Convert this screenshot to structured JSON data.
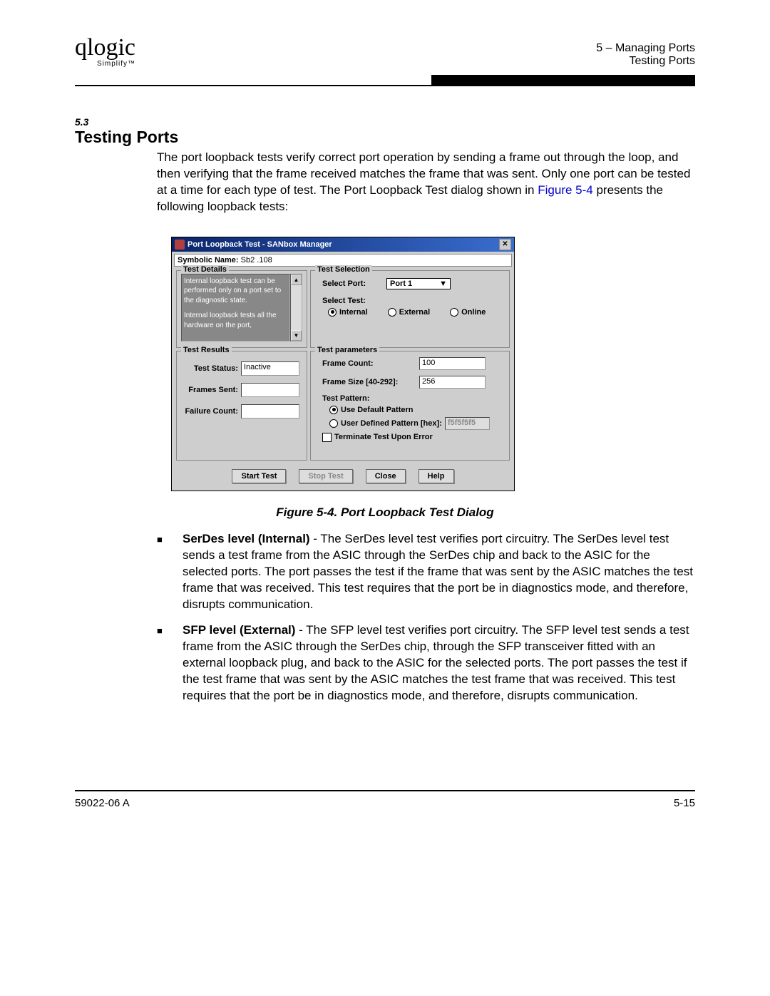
{
  "header": {
    "logo": "qlogic",
    "logo_sub": "Simplify™",
    "chapter": "5 – Managing Ports",
    "page_topic": "Testing Ports"
  },
  "section": {
    "num": "5.3",
    "title": "Testing Ports",
    "intro_a": "The port loopback tests verify correct port operation by sending a frame out through the loop, and then verifying that the frame received matches the frame that was sent. Only one port can be tested at a time for each type of test. The Port Loopback Test dialog shown in ",
    "intro_link": "Figure 5-4",
    "intro_b": " presents the following loopback tests:"
  },
  "dialog": {
    "title": "Port Loopback Test - SANbox Manager",
    "sym_label": "Symbolic Name:",
    "sym_value": "Sb2 .108",
    "details_label": "Test Details",
    "details_p1": "Internal loopback test can be performed only on a port set to the diagnostic state.",
    "details_p2": "Internal loopback tests all the hardware on the port,",
    "selection_label": "Test Selection",
    "select_port_label": "Select Port:",
    "select_port_value": "Port 1",
    "select_test_label": "Select Test:",
    "radio_internal": "Internal",
    "radio_external": "External",
    "radio_online": "Online",
    "results_label": "Test Results",
    "test_status_label": "Test Status:",
    "test_status_value": "Inactive",
    "frames_sent_label": "Frames Sent:",
    "frames_sent_value": "",
    "failure_count_label": "Failure Count:",
    "failure_count_value": "",
    "params_label": "Test parameters",
    "frame_count_label": "Frame Count:",
    "frame_count_value": "100",
    "frame_size_label": "Frame Size [40-292]:",
    "frame_size_value": "256",
    "test_pattern_label": "Test Pattern:",
    "use_default_label": "Use Default Pattern",
    "user_defined_label": "User Defined Pattern [hex]:",
    "user_defined_value": "f5f5f5f5",
    "terminate_label": "Terminate Test Upon Error",
    "btn_start": "Start Test",
    "btn_stop": "Stop Test",
    "btn_close": "Close",
    "btn_help": "Help"
  },
  "figure_caption": "Figure 5-4.  Port Loopback Test Dialog",
  "bullets": {
    "b1_bold": "SerDes level (Internal)",
    "b1_text": " - The SerDes level test verifies port circuitry. The SerDes level test sends a test frame from the ASIC through the SerDes chip and back to the ASIC for the selected ports. The port passes the test if the frame that was sent by the ASIC matches the test frame that was received. This test requires that the port be in diagnostics mode, and therefore, disrupts communication.",
    "b2_bold": "SFP level (External)",
    "b2_text": " - The SFP level test verifies port circuitry. The SFP level test sends a test frame from the ASIC through the SerDes chip, through the SFP transceiver fitted with an external loopback plug, and back to the ASIC for the selected ports. The port passes the test if the test frame that was sent by the ASIC matches the test frame that was received. This test requires that the port be in diagnostics mode, and therefore, disrupts communication."
  },
  "footer": {
    "left": "59022-06  A",
    "right": "5-15"
  }
}
